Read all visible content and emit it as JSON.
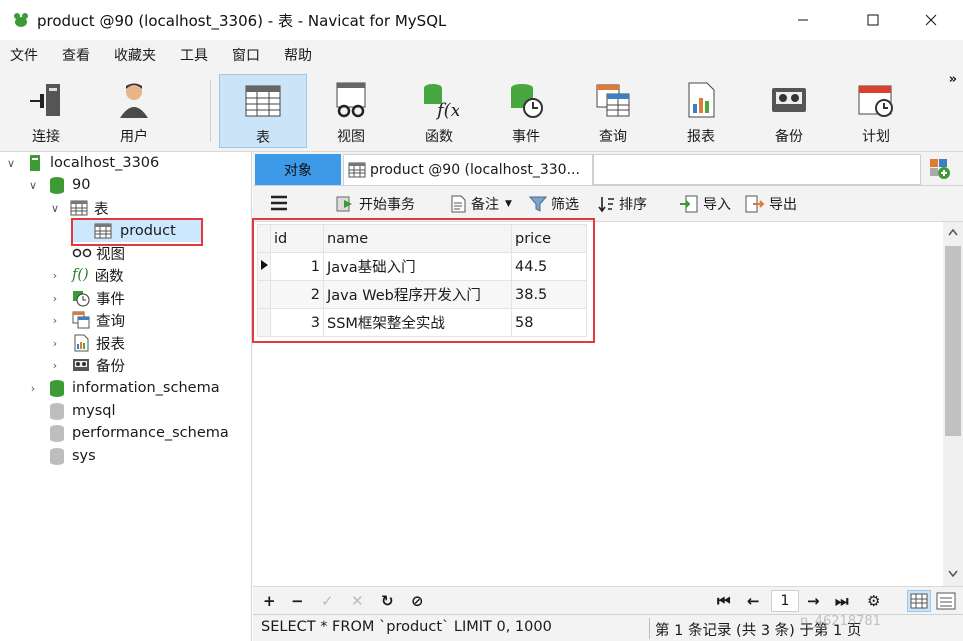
{
  "window": {
    "title": "product @90 (localhost_3306) - 表 - Navicat for MySQL"
  },
  "menu": [
    "文件",
    "查看",
    "收藏夹",
    "工具",
    "窗口",
    "帮助"
  ],
  "toolbar": {
    "items": [
      {
        "label": "连接",
        "icon": "connection-icon"
      },
      {
        "label": "用户",
        "icon": "user-icon"
      },
      {
        "label": "表",
        "icon": "table-icon",
        "active": true
      },
      {
        "label": "视图",
        "icon": "view-icon"
      },
      {
        "label": "函数",
        "icon": "function-icon"
      },
      {
        "label": "事件",
        "icon": "event-icon"
      },
      {
        "label": "查询",
        "icon": "query-icon"
      },
      {
        "label": "报表",
        "icon": "report-icon"
      },
      {
        "label": "备份",
        "icon": "backup-icon"
      },
      {
        "label": "计划",
        "icon": "schedule-icon"
      }
    ],
    "more": "»"
  },
  "tree": {
    "connection": "localhost_3306",
    "db": "90",
    "tables_group": "表",
    "selected_table": "product",
    "children": [
      "视图",
      "函数",
      "事件",
      "查询",
      "报表",
      "备份"
    ],
    "other_dbs": [
      "information_schema",
      "mysql",
      "performance_schema",
      "sys"
    ]
  },
  "tabs": {
    "objects": "对象",
    "doc": "product @90 (localhost_330..."
  },
  "subtoolbar": {
    "begin_tx": "开始事务",
    "note": "备注",
    "filter": "筛选",
    "sort": "排序",
    "import": "导入",
    "export": "导出"
  },
  "grid": {
    "columns": [
      "id",
      "name",
      "price"
    ],
    "rows": [
      {
        "id": "1",
        "name": "Java基础入门",
        "price": "44.5"
      },
      {
        "id": "2",
        "name": "Java Web程序开发入门",
        "price": "38.5"
      },
      {
        "id": "3",
        "name": "SSM框架整全实战",
        "price": "58"
      }
    ]
  },
  "pager": {
    "page": "1"
  },
  "status": {
    "query": "SELECT * FROM `product` LIMIT 0, 1000",
    "records": "第 1 条记录 (共 3 条) 于第 1 页"
  },
  "watermark": "n_46218781",
  "colors": {
    "accent": "#3c9ae8",
    "highlight": "#e0393e",
    "selection": "#cce8ff"
  }
}
